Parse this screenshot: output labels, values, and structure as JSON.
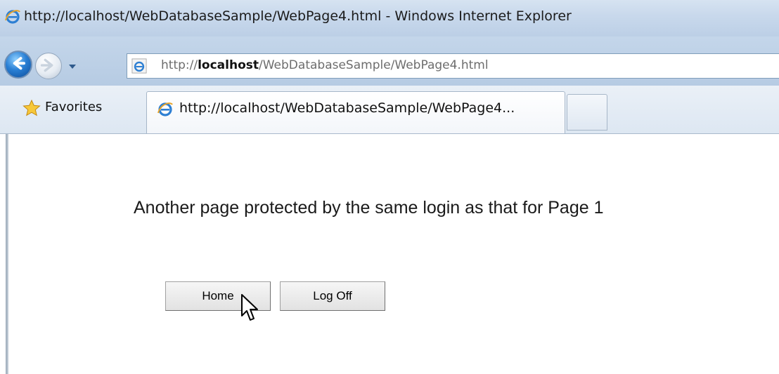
{
  "window": {
    "title": "http://localhost/WebDatabaseSample/WebPage4.html - Windows Internet Explorer"
  },
  "nav": {
    "address_prefix": "http://",
    "address_host": "localhost",
    "address_path": "/WebDatabaseSample/WebPage4.html"
  },
  "favorites_bar": {
    "favorites_label": "Favorites",
    "active_tab_label": "http://localhost/WebDatabaseSample/WebPage4..."
  },
  "page": {
    "heading": "Another page protected by the same login as that for Page 1",
    "buttons": {
      "home_label": "Home",
      "logoff_label": "Log Off"
    }
  },
  "icons": {
    "ie": "internet-explorer-icon",
    "back": "back-arrow-icon",
    "forward": "forward-arrow-icon",
    "favorites": "star-icon",
    "cursor": "mouse-pointer-icon"
  }
}
